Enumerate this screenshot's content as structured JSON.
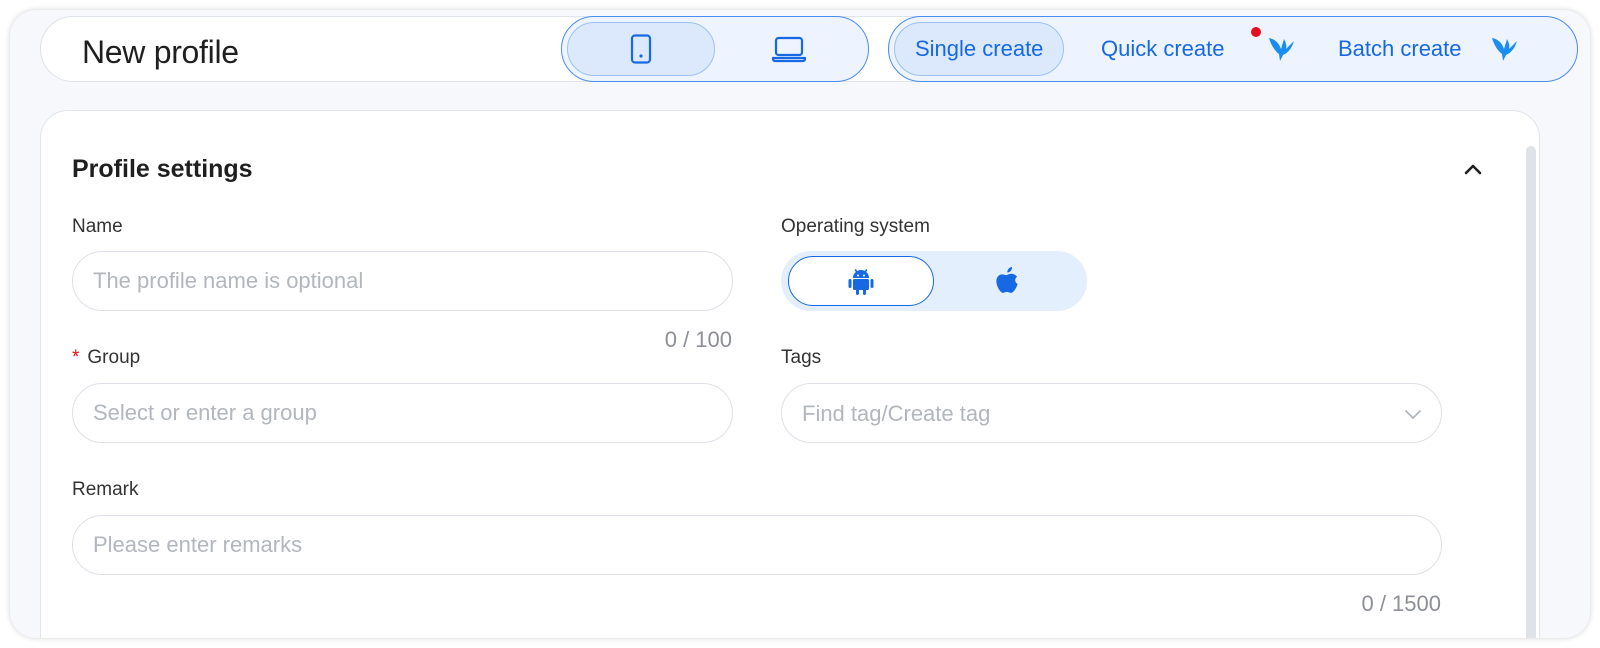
{
  "header": {
    "title": "New profile",
    "device_options": [
      {
        "name": "mobile",
        "icon": "phone-icon",
        "active": true
      },
      {
        "name": "desktop",
        "icon": "laptop-icon",
        "active": false
      }
    ],
    "mode_tabs": [
      {
        "label": "Single create",
        "active": true
      },
      {
        "label": "Quick create",
        "badge": "red-dot",
        "icon": "bird-icon"
      },
      {
        "label": "Batch create",
        "icon": "bird-icon"
      }
    ]
  },
  "profile_settings": {
    "title": "Profile settings",
    "name": {
      "label": "Name",
      "placeholder": "The profile name is optional",
      "value": "",
      "counter": "0 / 100"
    },
    "operating_system": {
      "label": "Operating system",
      "options": [
        {
          "name": "android",
          "icon": "android-icon",
          "active": true
        },
        {
          "name": "ios",
          "icon": "apple-icon",
          "active": false
        }
      ]
    },
    "group": {
      "label": "Group",
      "required_mark": "*",
      "placeholder": "Select or enter a group",
      "value": ""
    },
    "tags": {
      "label": "Tags",
      "placeholder": "Find tag/Create tag"
    },
    "remark": {
      "label": "Remark",
      "placeholder": "Please enter remarks",
      "value": "",
      "counter": "0 / 1500"
    }
  },
  "colors": {
    "accent": "#1668e3",
    "accent_light": "#dce9fc",
    "required": "#e4101c",
    "text": "#1f1f1f",
    "placeholder": "#b2b6bd"
  }
}
